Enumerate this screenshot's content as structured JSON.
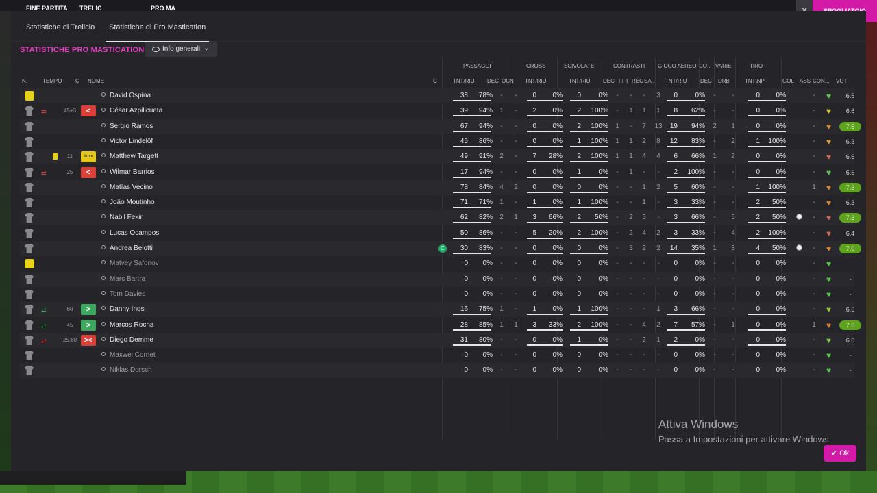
{
  "background": {
    "top_left_label": "FINE PARTITA",
    "score_left": "TRELIC",
    "score_right": "PRO MA",
    "top_right_button": "SPOGLIATOIO",
    "close_icon": "close-icon"
  },
  "tabs": [
    "Statistiche di Trelicio",
    "Statistiche di Pro Mastication"
  ],
  "active_tab": 1,
  "section_title": "STATISTICHE PRO MASTICATION",
  "view_dropdown": {
    "label": "Info generali",
    "icon": "eye-icon"
  },
  "groups": {
    "passaggi": "PASSAGGI",
    "cross": "CROSS",
    "scivolate": "SCIVOLATE",
    "contrasti": "CONTRASTI",
    "gioco_aereo": "GIOCO AEREO",
    "co": "CO...",
    "varie": "VARIE",
    "tiro": "TIRO"
  },
  "columns": {
    "n": "N.",
    "tempo": "TEMPO",
    "c": "C",
    "nome": "NOME",
    "cap": "C",
    "pass_tnt": "TNT/RIU",
    "pass_dec": "DEC",
    "pass_ocn": "OCN",
    "cross_tnt": "TNT/RIU",
    "sciv_tnt": "TNT/RIU",
    "con_dec": "DEC",
    "con_fft": "FFT",
    "con_rec": "REC",
    "con_sa": "SA...",
    "aereo_tnt": "TNT/RIU",
    "co_dec": "DEC",
    "drb": "DRB",
    "tiro": "TNT\\NP",
    "gol": "GOL",
    "ass": "ASS",
    "con": "CON...",
    "vot": "VOT"
  },
  "players": [
    {
      "name": "David Ospina",
      "gk": true,
      "played": true,
      "tempo": "",
      "sub": "",
      "card": false,
      "p_t": "38",
      "p_pct": "78%",
      "p_dec": "-",
      "p_ocn": "-",
      "c_t": "0",
      "c_pct": "0%",
      "s_t": "0",
      "s_pct": "0%",
      "k_dec": "-",
      "k_fft": "-",
      "k_rec": "-",
      "k_sa": "3",
      "a_t": "0",
      "a_pct": "0%",
      "co_dec": "-",
      "drb": "-",
      "t_t": "0",
      "t_pct": "0%",
      "gol": false,
      "ass": "-",
      "heart": "#58c94a",
      "vot": "6.5",
      "vot_good": false,
      "captain": false
    },
    {
      "name": "César Azpilicueta",
      "gk": false,
      "played": true,
      "tempo": "45+3",
      "sub": "out",
      "card": false,
      "p_t": "39",
      "p_pct": "94%",
      "p_dec": "1",
      "p_ocn": "-",
      "c_t": "2",
      "c_pct": "0%",
      "s_t": "2",
      "s_pct": "100%",
      "k_dec": "-",
      "k_fft": "1",
      "k_rec": "1",
      "k_sa": "1",
      "a_t": "8",
      "a_pct": "62%",
      "co_dec": "-",
      "drb": "-",
      "t_t": "0",
      "t_pct": "0%",
      "gol": false,
      "ass": "-",
      "heart": "#d6c72e",
      "vot": "6.6",
      "vot_good": false,
      "captain": false
    },
    {
      "name": "Sergio Ramos",
      "gk": false,
      "played": true,
      "tempo": "",
      "sub": "",
      "card": false,
      "p_t": "67",
      "p_pct": "94%",
      "p_dec": "-",
      "p_ocn": "-",
      "c_t": "0",
      "c_pct": "0%",
      "s_t": "2",
      "s_pct": "100%",
      "k_dec": "1",
      "k_fft": "-",
      "k_rec": "7",
      "k_sa": "13",
      "a_t": "19",
      "a_pct": "94%",
      "co_dec": "2",
      "drb": "1",
      "t_t": "0",
      "t_pct": "0%",
      "gol": false,
      "ass": "-",
      "heart": "#d8883a",
      "vot": "7.5",
      "vot_good": true,
      "captain": false
    },
    {
      "name": "Victor Lindelöf",
      "gk": false,
      "played": true,
      "tempo": "",
      "sub": "",
      "card": false,
      "p_t": "45",
      "p_pct": "86%",
      "p_dec": "-",
      "p_ocn": "-",
      "c_t": "0",
      "c_pct": "0%",
      "s_t": "1",
      "s_pct": "100%",
      "k_dec": "1",
      "k_fft": "1",
      "k_rec": "2",
      "k_sa": "8",
      "a_t": "12",
      "a_pct": "83%",
      "co_dec": "-",
      "drb": "2",
      "t_t": "1",
      "t_pct": "100%",
      "gol": false,
      "ass": "-",
      "heart": "#e0a030",
      "vot": "6.3",
      "vot_good": false,
      "captain": false
    },
    {
      "name": "Matthew Targett",
      "gk": false,
      "played": true,
      "tempo": "11",
      "sub": "amm",
      "card": true,
      "p_t": "49",
      "p_pct": "91%",
      "p_dec": "2",
      "p_ocn": "-",
      "c_t": "7",
      "c_pct": "28%",
      "s_t": "2",
      "s_pct": "100%",
      "k_dec": "1",
      "k_fft": "1",
      "k_rec": "4",
      "k_sa": "4",
      "a_t": "6",
      "a_pct": "66%",
      "co_dec": "1",
      "drb": "2",
      "t_t": "0",
      "t_pct": "0%",
      "gol": false,
      "ass": "-",
      "heart": "#d06a5a",
      "vot": "6.6",
      "vot_good": false,
      "captain": false
    },
    {
      "name": "Wilmar Barrios",
      "gk": false,
      "played": true,
      "tempo": "25",
      "sub": "out",
      "card": false,
      "p_t": "17",
      "p_pct": "94%",
      "p_dec": "-",
      "p_ocn": "-",
      "c_t": "0",
      "c_pct": "0%",
      "s_t": "1",
      "s_pct": "0%",
      "k_dec": "-",
      "k_fft": "1",
      "k_rec": "-",
      "k_sa": "-",
      "a_t": "2",
      "a_pct": "100%",
      "co_dec": "-",
      "drb": "-",
      "t_t": "0",
      "t_pct": "0%",
      "gol": false,
      "ass": "-",
      "heart": "#58c94a",
      "vot": "6.5",
      "vot_good": false,
      "captain": false
    },
    {
      "name": "Matías Vecino",
      "gk": false,
      "played": true,
      "tempo": "",
      "sub": "",
      "card": false,
      "p_t": "78",
      "p_pct": "84%",
      "p_dec": "4",
      "p_ocn": "2",
      "c_t": "0",
      "c_pct": "0%",
      "s_t": "0",
      "s_pct": "0%",
      "k_dec": "-",
      "k_fft": "-",
      "k_rec": "1",
      "k_sa": "2",
      "a_t": "5",
      "a_pct": "60%",
      "co_dec": "-",
      "drb": "-",
      "t_t": "1",
      "t_pct": "100%",
      "gol": false,
      "ass": "1",
      "heart": "#d8883a",
      "vot": "7.3",
      "vot_good": true,
      "captain": false
    },
    {
      "name": "João Moutinho",
      "gk": false,
      "played": true,
      "tempo": "",
      "sub": "",
      "card": false,
      "p_t": "71",
      "p_pct": "71%",
      "p_dec": "1",
      "p_ocn": "-",
      "c_t": "1",
      "c_pct": "0%",
      "s_t": "1",
      "s_pct": "100%",
      "k_dec": "-",
      "k_fft": "-",
      "k_rec": "1",
      "k_sa": "-",
      "a_t": "3",
      "a_pct": "33%",
      "co_dec": "-",
      "drb": "-",
      "t_t": "2",
      "t_pct": "50%",
      "gol": false,
      "ass": "-",
      "heart": "#d8883a",
      "vot": "6.3",
      "vot_good": false,
      "captain": false
    },
    {
      "name": "Nabil Fekir",
      "gk": false,
      "played": true,
      "tempo": "",
      "sub": "",
      "card": false,
      "p_t": "62",
      "p_pct": "82%",
      "p_dec": "2",
      "p_ocn": "1",
      "c_t": "3",
      "c_pct": "66%",
      "s_t": "2",
      "s_pct": "50%",
      "k_dec": "-",
      "k_fft": "2",
      "k_rec": "5",
      "k_sa": "-",
      "a_t": "3",
      "a_pct": "66%",
      "co_dec": "-",
      "drb": "5",
      "t_t": "2",
      "t_pct": "50%",
      "gol": true,
      "ass": "-",
      "heart": "#d06a5a",
      "vot": "7.3",
      "vot_good": true,
      "captain": false
    },
    {
      "name": "Lucas Ocampos",
      "gk": false,
      "played": true,
      "tempo": "",
      "sub": "",
      "card": false,
      "p_t": "50",
      "p_pct": "86%",
      "p_dec": "-",
      "p_ocn": "-",
      "c_t": "5",
      "c_pct": "20%",
      "s_t": "2",
      "s_pct": "100%",
      "k_dec": "-",
      "k_fft": "2",
      "k_rec": "4",
      "k_sa": "2",
      "a_t": "3",
      "a_pct": "33%",
      "co_dec": "-",
      "drb": "4",
      "t_t": "2",
      "t_pct": "100%",
      "gol": false,
      "ass": "-",
      "heart": "#d06a5a",
      "vot": "6.4",
      "vot_good": false,
      "captain": false
    },
    {
      "name": "Andrea Belotti",
      "gk": false,
      "played": true,
      "tempo": "",
      "sub": "",
      "card": false,
      "p_t": "30",
      "p_pct": "83%",
      "p_dec": "-",
      "p_ocn": "-",
      "c_t": "0",
      "c_pct": "0%",
      "s_t": "0",
      "s_pct": "0%",
      "k_dec": "-",
      "k_fft": "3",
      "k_rec": "2",
      "k_sa": "2",
      "a_t": "14",
      "a_pct": "35%",
      "co_dec": "1",
      "drb": "3",
      "t_t": "4",
      "t_pct": "50%",
      "gol": true,
      "ass": "-",
      "heart": "#d8883a",
      "vot": "7.0",
      "vot_good": true,
      "captain": true
    },
    {
      "name": "Matvey Safonov",
      "gk": true,
      "played": false,
      "tempo": "",
      "sub": "",
      "card": false,
      "p_t": "0",
      "p_pct": "0%",
      "p_dec": "-",
      "p_ocn": "-",
      "c_t": "0",
      "c_pct": "0%",
      "s_t": "0",
      "s_pct": "0%",
      "k_dec": "-",
      "k_fft": "-",
      "k_rec": "-",
      "k_sa": "-",
      "a_t": "0",
      "a_pct": "0%",
      "co_dec": "-",
      "drb": "-",
      "t_t": "0",
      "t_pct": "0%",
      "gol": false,
      "ass": "-",
      "heart": "#58c94a",
      "vot": "-",
      "vot_good": false,
      "captain": false
    },
    {
      "name": "Marc Bartra",
      "gk": false,
      "played": false,
      "tempo": "",
      "sub": "",
      "card": false,
      "p_t": "0",
      "p_pct": "0%",
      "p_dec": "-",
      "p_ocn": "-",
      "c_t": "0",
      "c_pct": "0%",
      "s_t": "0",
      "s_pct": "0%",
      "k_dec": "-",
      "k_fft": "-",
      "k_rec": "-",
      "k_sa": "-",
      "a_t": "0",
      "a_pct": "0%",
      "co_dec": "-",
      "drb": "-",
      "t_t": "0",
      "t_pct": "0%",
      "gol": false,
      "ass": "-",
      "heart": "#58c94a",
      "vot": "-",
      "vot_good": false,
      "captain": false
    },
    {
      "name": "Tom Davies",
      "gk": false,
      "played": false,
      "tempo": "",
      "sub": "",
      "card": false,
      "p_t": "0",
      "p_pct": "0%",
      "p_dec": "-",
      "p_ocn": "-",
      "c_t": "0",
      "c_pct": "0%",
      "s_t": "0",
      "s_pct": "0%",
      "k_dec": "-",
      "k_fft": "-",
      "k_rec": "-",
      "k_sa": "-",
      "a_t": "0",
      "a_pct": "0%",
      "co_dec": "-",
      "drb": "-",
      "t_t": "0",
      "t_pct": "0%",
      "gol": false,
      "ass": "-",
      "heart": "#58c94a",
      "vot": "-",
      "vot_good": false,
      "captain": false
    },
    {
      "name": "Danny Ings",
      "gk": false,
      "played": true,
      "tempo": "60",
      "sub": "in",
      "card": false,
      "p_t": "16",
      "p_pct": "75%",
      "p_dec": "1",
      "p_ocn": "-",
      "c_t": "1",
      "c_pct": "0%",
      "s_t": "1",
      "s_pct": "100%",
      "k_dec": "-",
      "k_fft": "-",
      "k_rec": "-",
      "k_sa": "1",
      "a_t": "3",
      "a_pct": "66%",
      "co_dec": "-",
      "drb": "-",
      "t_t": "0",
      "t_pct": "0%",
      "gol": false,
      "ass": "-",
      "heart": "#9ac93a",
      "vot": "6.6",
      "vot_good": false,
      "captain": false
    },
    {
      "name": "Marcos Rocha",
      "gk": false,
      "played": true,
      "tempo": "45",
      "sub": "in",
      "card": false,
      "p_t": "28",
      "p_pct": "85%",
      "p_dec": "1",
      "p_ocn": "1",
      "c_t": "3",
      "c_pct": "33%",
      "s_t": "2",
      "s_pct": "100%",
      "k_dec": "-",
      "k_fft": "-",
      "k_rec": "4",
      "k_sa": "2",
      "a_t": "7",
      "a_pct": "57%",
      "co_dec": "-",
      "drb": "1",
      "t_t": "0",
      "t_pct": "0%",
      "gol": false,
      "ass": "1",
      "heart": "#d8883a",
      "vot": "7.5",
      "vot_good": true,
      "captain": false
    },
    {
      "name": "Diego Demme",
      "gk": false,
      "played": true,
      "tempo": "25,60",
      "sub": "inout",
      "card": false,
      "p_t": "31",
      "p_pct": "80%",
      "p_dec": "-",
      "p_ocn": "-",
      "c_t": "0",
      "c_pct": "0%",
      "s_t": "1",
      "s_pct": "0%",
      "k_dec": "-",
      "k_fft": "-",
      "k_rec": "2",
      "k_sa": "1",
      "a_t": "2",
      "a_pct": "0%",
      "co_dec": "-",
      "drb": "-",
      "t_t": "0",
      "t_pct": "0%",
      "gol": false,
      "ass": "-",
      "heart": "#7ac94a",
      "vot": "6.6",
      "vot_good": false,
      "captain": false
    },
    {
      "name": "Maxwel Cornet",
      "gk": false,
      "played": false,
      "tempo": "",
      "sub": "",
      "card": false,
      "p_t": "0",
      "p_pct": "0%",
      "p_dec": "-",
      "p_ocn": "-",
      "c_t": "0",
      "c_pct": "0%",
      "s_t": "0",
      "s_pct": "0%",
      "k_dec": "-",
      "k_fft": "-",
      "k_rec": "-",
      "k_sa": "-",
      "a_t": "0",
      "a_pct": "0%",
      "co_dec": "-",
      "drb": "-",
      "t_t": "0",
      "t_pct": "0%",
      "gol": false,
      "ass": "-",
      "heart": "#58c94a",
      "vot": "-",
      "vot_good": false,
      "captain": false
    },
    {
      "name": "Niklas Dorsch",
      "gk": false,
      "played": false,
      "tempo": "",
      "sub": "",
      "card": false,
      "p_t": "0",
      "p_pct": "0%",
      "p_dec": "-",
      "p_ocn": "-",
      "c_t": "0",
      "c_pct": "0%",
      "s_t": "0",
      "s_pct": "0%",
      "k_dec": "-",
      "k_fft": "-",
      "k_rec": "-",
      "k_sa": "-",
      "a_t": "0",
      "a_pct": "0%",
      "co_dec": "-",
      "drb": "-",
      "t_t": "0",
      "t_pct": "0%",
      "gol": false,
      "ass": "-",
      "heart": "#58c94a",
      "vot": "-",
      "vot_good": false,
      "captain": false
    }
  ],
  "watermark": {
    "line1": "Attiva Windows",
    "line2": "Passa a Impostazioni per attivare Windows."
  },
  "ok_button": "Ok",
  "colors": {
    "accent": "#d21aa6",
    "title": "#e83ec4",
    "good_rating": "#5ea31e",
    "sub_out": "#d9403a",
    "sub_in": "#3fa860"
  }
}
